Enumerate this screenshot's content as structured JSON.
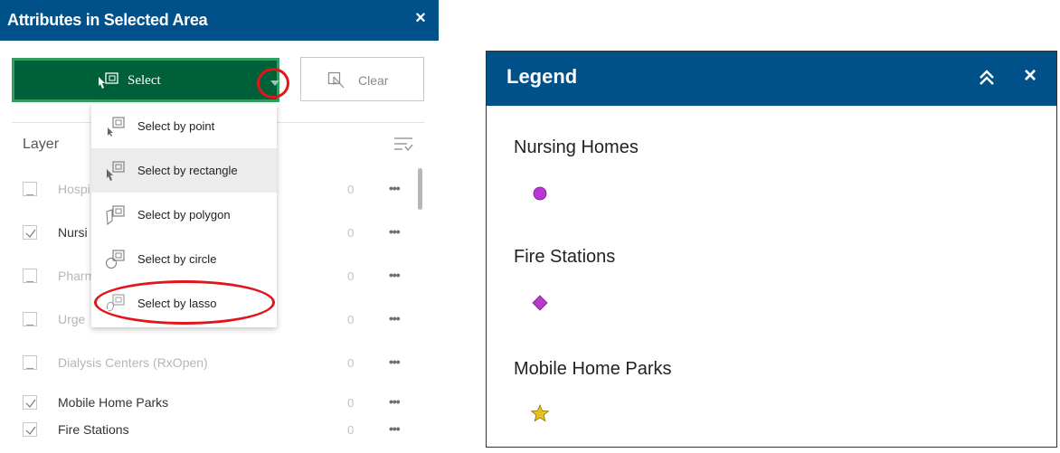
{
  "attributes_panel": {
    "title": "Attributes in Selected Area",
    "close_glyph": "×",
    "select_button": {
      "label": "Select",
      "icon": "select-rectangle-icon"
    },
    "clear_button": {
      "label": "Clear",
      "icon": "clear-selection-icon"
    },
    "layer_heading": "Layer",
    "filter_icon": "filter-list-icon",
    "more_glyph": "•••",
    "layers": [
      {
        "name": "Hospi",
        "count": "0",
        "checked": false
      },
      {
        "name": "Nursi",
        "count": "0",
        "checked": true
      },
      {
        "name": "Pharm",
        "count": "0",
        "checked": false
      },
      {
        "name": "Urge",
        "count": "0",
        "checked": false
      },
      {
        "name": "Dialysis Centers (RxOpen)",
        "count": "0",
        "checked": false
      },
      {
        "name": "Mobile Home Parks",
        "count": "0",
        "checked": true
      },
      {
        "name": "Fire Stations",
        "count": "0",
        "checked": true
      }
    ],
    "select_menu": [
      {
        "label": "Select by point",
        "icon": "select-point-icon"
      },
      {
        "label": "Select by rectangle",
        "icon": "select-rectangle-icon"
      },
      {
        "label": "Select by polygon",
        "icon": "select-polygon-icon"
      },
      {
        "label": "Select by circle",
        "icon": "select-circle-icon"
      },
      {
        "label": "Select by lasso",
        "icon": "select-lasso-icon"
      }
    ]
  },
  "legend_panel": {
    "title": "Legend",
    "collapse_glyph": "⌃",
    "close_glyph": "×",
    "layers": [
      {
        "title": "Nursing Homes",
        "symbol": "circle",
        "color": "#b835d6"
      },
      {
        "title": "Fire Stations",
        "symbol": "diamond",
        "color": "#b43bc9"
      },
      {
        "title": "Mobile Home Parks",
        "symbol": "star",
        "color": "#e8c21a"
      }
    ]
  },
  "colors": {
    "header": "#00508a",
    "select_button": "#00603a",
    "annotation_red": "#e3141b"
  }
}
